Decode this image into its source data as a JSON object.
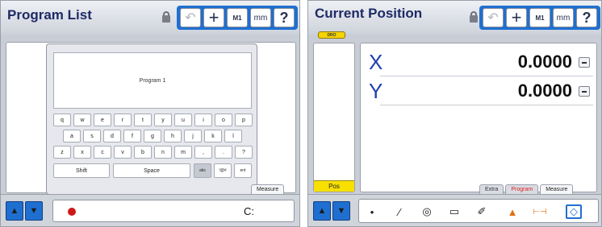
{
  "left": {
    "title": "Program List",
    "toolbar": {
      "undo": "↶",
      "plus": "+",
      "m1": "M1",
      "mm": "mm",
      "help": "?"
    },
    "entry_text": "Program 1",
    "keyboard": {
      "row1": [
        "q",
        "w",
        "e",
        "r",
        "t",
        "y",
        "u",
        "i",
        "o",
        "p"
      ],
      "row2": [
        "a",
        "s",
        "d",
        "f",
        "g",
        "h",
        "j",
        "k",
        "l"
      ],
      "row3": [
        "z",
        "x",
        "c",
        "v",
        "b",
        "n",
        "m",
        ",",
        ".",
        "?"
      ],
      "shift": "Shift",
      "space": "Space",
      "mode_keys": [
        "abc",
        "!@#",
        "ent"
      ]
    },
    "tabs": [
      "Measure"
    ],
    "bottom": {
      "drive": "C:"
    }
  },
  "right": {
    "title": "Current Position",
    "toolbar": {
      "undo": "↶",
      "plus": "+",
      "m1": "M1",
      "mm": "mm",
      "help": "?"
    },
    "dro_badge": "DRO",
    "pos_button": "Pos",
    "axes": [
      {
        "label": "X",
        "value": "0.0000"
      },
      {
        "label": "Y",
        "value": "0.0000"
      }
    ],
    "tabs": [
      "Extra",
      "Program",
      "Measure"
    ],
    "tools": [
      "•",
      "⁄",
      "◎",
      "▭",
      "✐",
      "▲",
      "⊢⊣",
      "◇"
    ]
  },
  "colors": {
    "accent": "#1f6fd1",
    "yellow": "#f5d400",
    "red": "#e02020"
  }
}
